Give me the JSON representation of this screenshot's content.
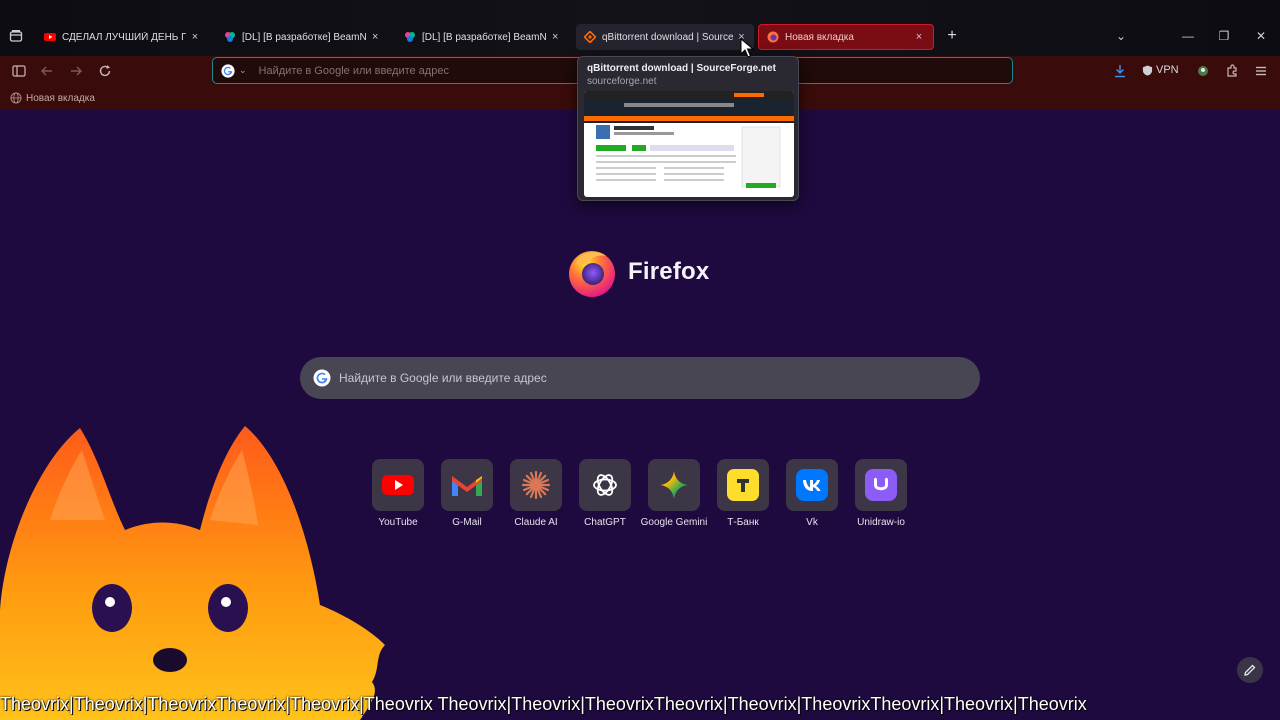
{
  "tabs": [
    {
      "label": "СДЕЛАЛ ЛУЧШИЙ ДЕНЬ ПАРН",
      "icon": "youtube-icon",
      "state": "normal"
    },
    {
      "label": "[DL] [В разработке] BeamNG.drive",
      "icon": "beamng-icon",
      "state": "normal"
    },
    {
      "label": "[DL] [В разработке] BeamNG.drive",
      "icon": "beamng-icon",
      "state": "normal"
    },
    {
      "label": "qBittorrent download | SourceForge.net",
      "icon": "sourceforge-icon",
      "state": "hovered"
    },
    {
      "label": "Новая вкладка",
      "icon": "firefox-icon",
      "state": "active"
    }
  ],
  "tab_close_glyph": "×",
  "new_tab_glyph": "+",
  "window_controls": {
    "minimize": "—",
    "restore": "❐",
    "close": "✕",
    "list_all": "⌄"
  },
  "urlbar": {
    "placeholder": "Найдите в Google или введите адрес",
    "engine_chevron": "⌄"
  },
  "toolbar": {
    "vpn_label": "VPN"
  },
  "bookmarks": [
    {
      "label": "Новая вкладка"
    }
  ],
  "tab_preview": {
    "title": "qBittorrent download | SourceForge.net",
    "url": "sourceforge.net"
  },
  "brand": {
    "name": "Firefox"
  },
  "main_search": {
    "placeholder": "Найдите в Google или введите адрес"
  },
  "shortcuts": [
    {
      "label": "YouTube",
      "icon": "youtube-icon"
    },
    {
      "label": "G-Mail",
      "icon": "gmail-icon"
    },
    {
      "label": "Claude AI",
      "icon": "claude-icon"
    },
    {
      "label": "ChatGPT",
      "icon": "chatgpt-icon"
    },
    {
      "label": "Google Gemini",
      "icon": "gemini-icon"
    },
    {
      "label": "Т-Банк",
      "icon": "tbank-icon"
    },
    {
      "label": "Vk",
      "icon": "vk-icon"
    },
    {
      "label": "Unidraw-io",
      "icon": "unidraw-icon"
    }
  ],
  "watermark": "Theovrix|Theovrix|TheovrixTheovrix|Theovrix|Theovrix Theovrix|Theovrix|TheovrixTheovrix|Theovrix|TheovrixTheovrix|Theovrix|Theovrix",
  "colors": {
    "page_bg": "#1f0a40",
    "toolbar_bg": "#3a0b0b",
    "active_tab": "#7a0c14",
    "urlbar_border": "#1a8a92"
  }
}
